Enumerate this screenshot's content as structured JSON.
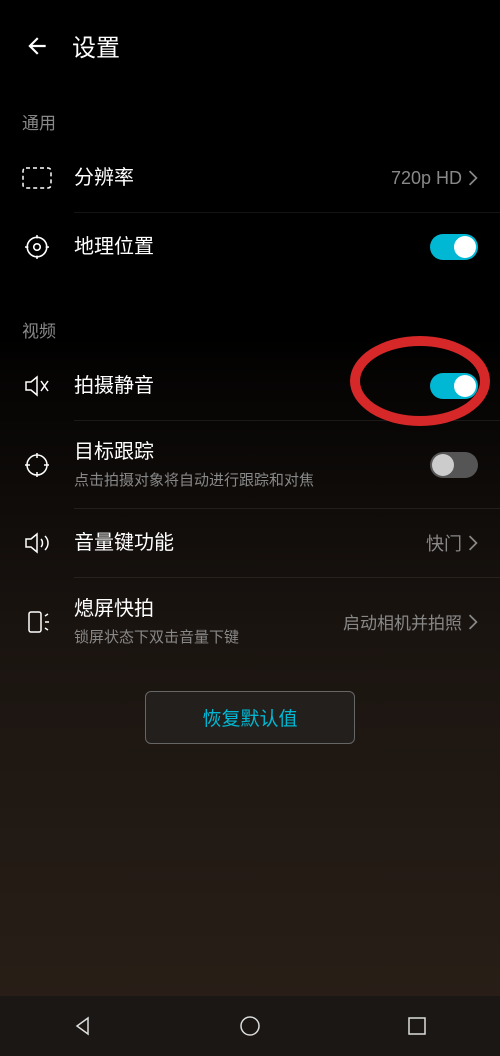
{
  "header": {
    "title": "设置"
  },
  "sections": {
    "general": {
      "label": "通用",
      "resolution": {
        "title": "分辨率",
        "value": "720p HD"
      },
      "location": {
        "title": "地理位置",
        "enabled": true
      }
    },
    "video": {
      "label": "视频",
      "mute": {
        "title": "拍摄静音",
        "enabled": true
      },
      "tracking": {
        "title": "目标跟踪",
        "subtitle": "点击拍摄对象将自动进行跟踪和对焦",
        "enabled": false
      },
      "volumeKey": {
        "title": "音量键功能",
        "value": "快门"
      },
      "quickSnap": {
        "title": "熄屏快拍",
        "subtitle": "锁屏状态下双击音量下键",
        "value": "启动相机并拍照"
      }
    }
  },
  "resetButton": "恢复默认值",
  "colors": {
    "accent": "#00b8d4",
    "annotation": "#d62828"
  }
}
